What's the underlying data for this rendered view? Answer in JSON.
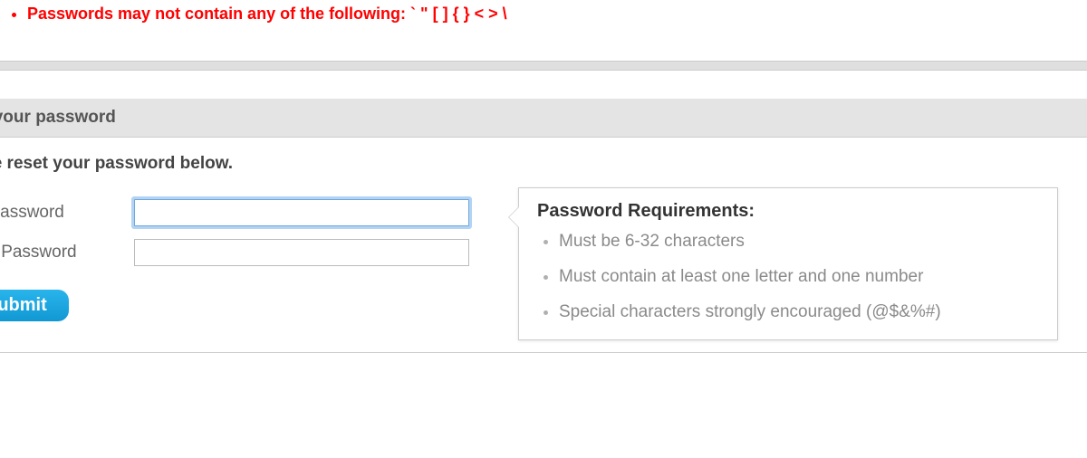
{
  "error": {
    "forbidden_chars_message": "Passwords may not contain any of the following: ` \" [ ] { } < > \\"
  },
  "section": {
    "heading": "set your password",
    "instruction": "ease reset your password below."
  },
  "form": {
    "enter_label": "ter Password",
    "retype_label": "type Password",
    "submit_label": "Submit"
  },
  "tooltip": {
    "title": "Password Requirements:",
    "rules": [
      "Must be 6-32 characters",
      "Must contain at least one letter and one number",
      "Special characters strongly encouraged (@$&%#)"
    ]
  }
}
